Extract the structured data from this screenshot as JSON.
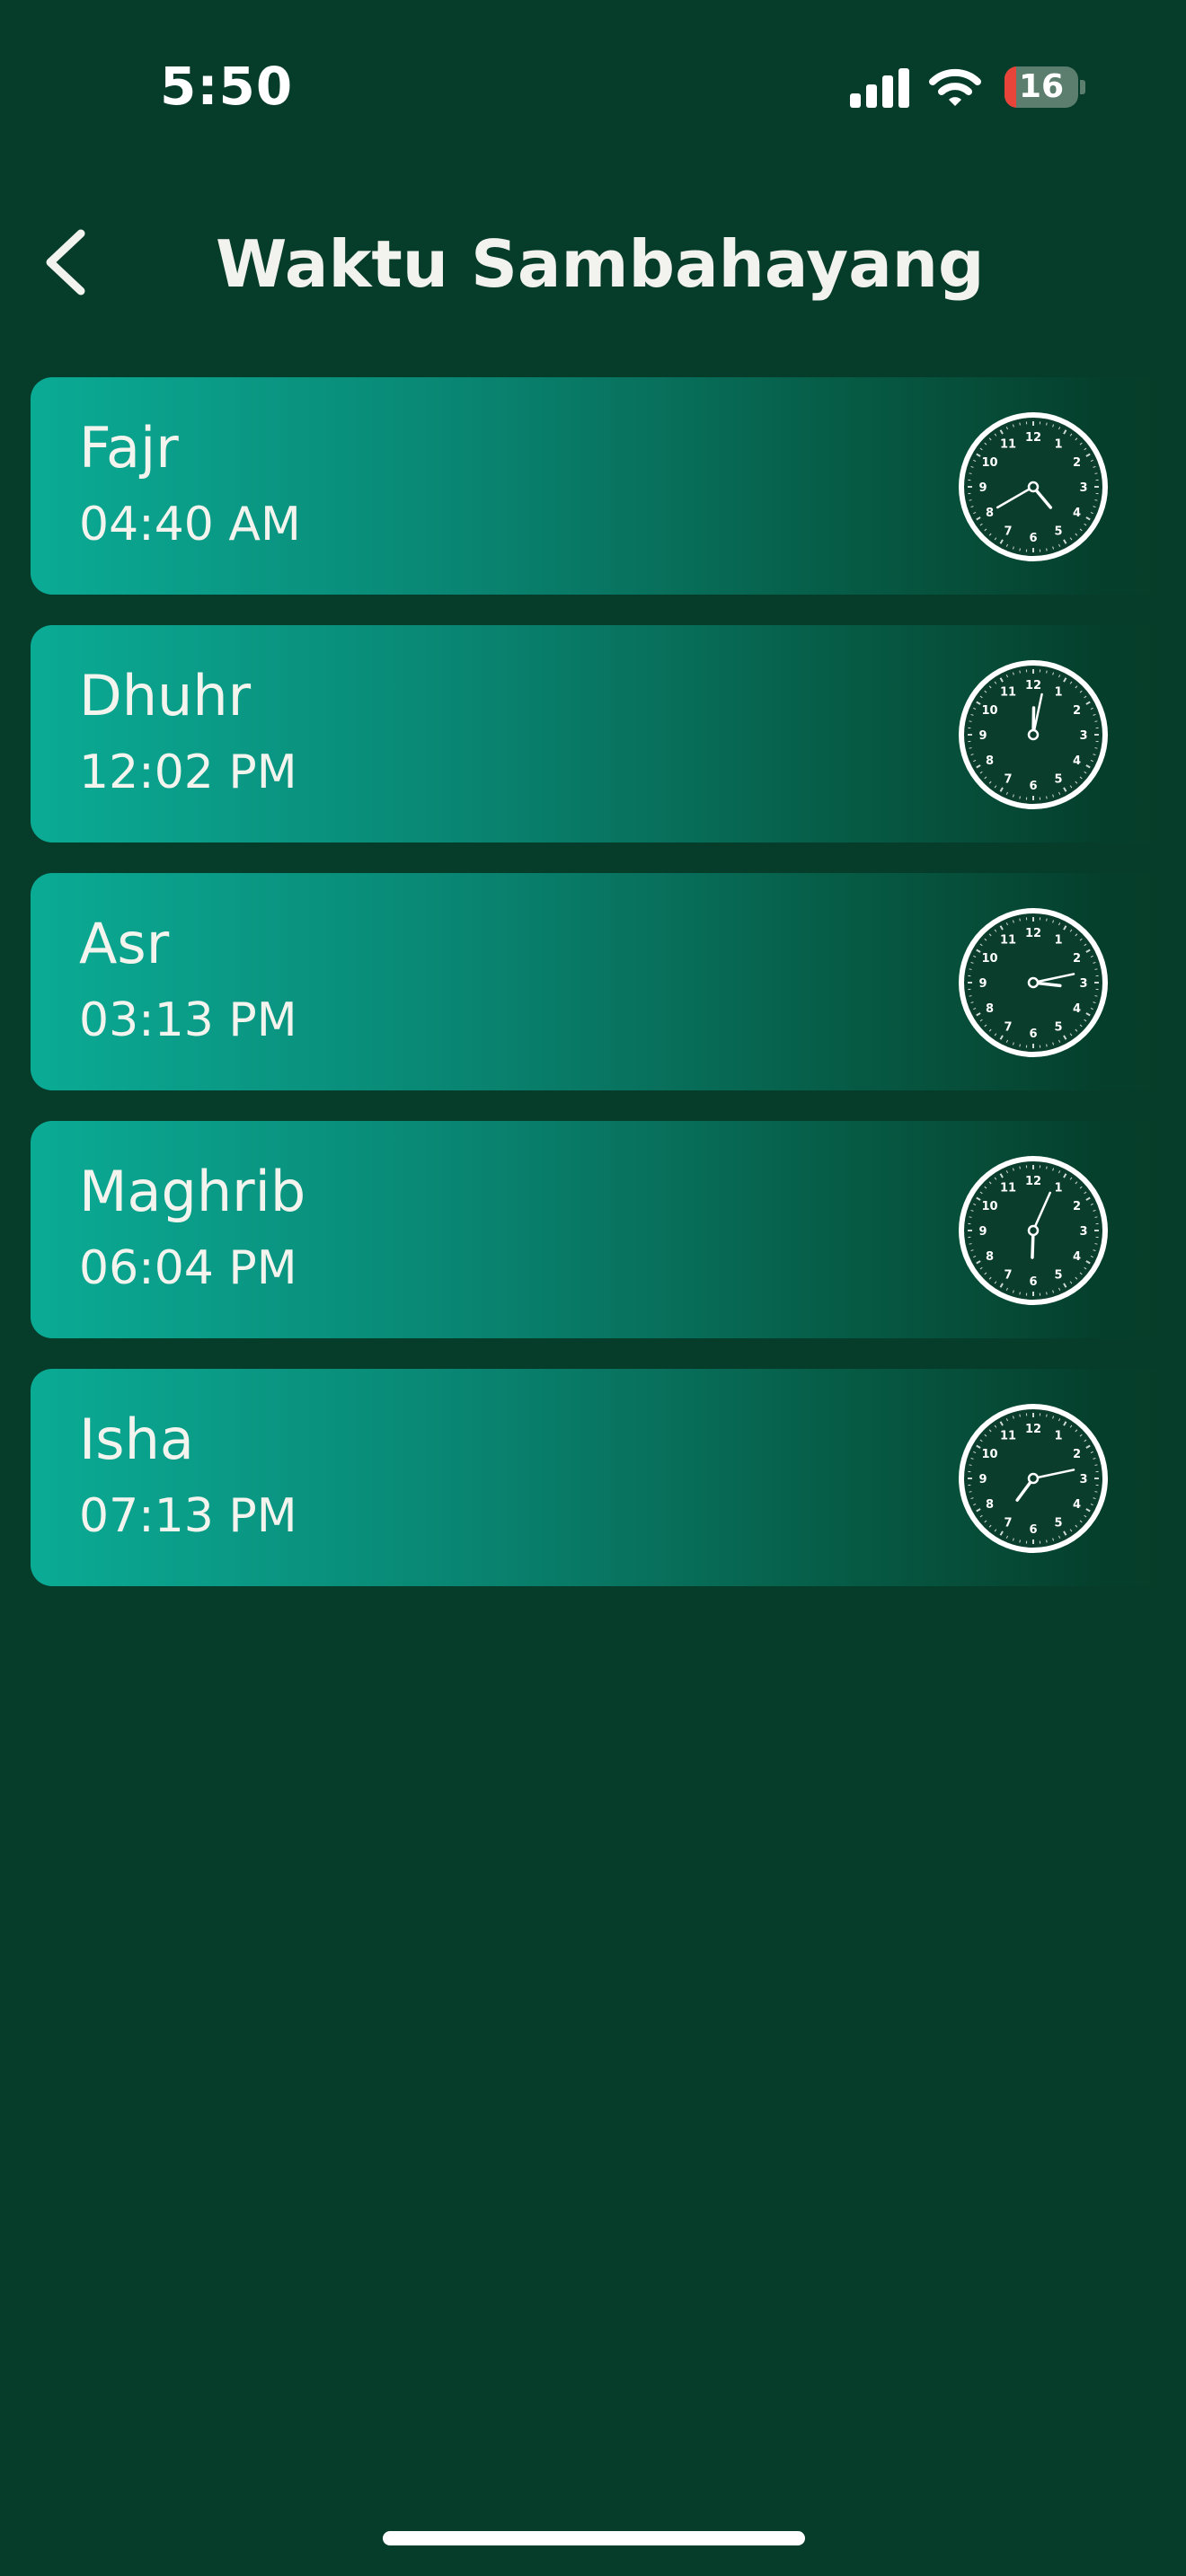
{
  "status_bar": {
    "time": "5:50",
    "battery_level": "16",
    "battery_fraction": 0.16,
    "signal_bars_active": 3,
    "signal_bars_total": 4
  },
  "header": {
    "title": "Waktu Sambahayang",
    "back_icon": "chevron-left-icon"
  },
  "prayers": [
    {
      "name": "Fajr",
      "time": "04:40 AM",
      "icon": "clock-icon"
    },
    {
      "name": "Dhuhr",
      "time": "12:02 PM",
      "icon": "clock-icon"
    },
    {
      "name": "Asr",
      "time": "03:13 PM",
      "icon": "clock-icon"
    },
    {
      "name": "Maghrib",
      "time": "06:04 PM",
      "icon": "clock-icon"
    },
    {
      "name": "Isha",
      "time": "07:13 PM",
      "icon": "clock-icon"
    }
  ],
  "colors": {
    "background": "#063d2a",
    "card_gradient_start": "#0aab95",
    "card_gradient_end": "#053e2b",
    "text": "#f2f2ee",
    "battery_low": "#e8443a"
  }
}
